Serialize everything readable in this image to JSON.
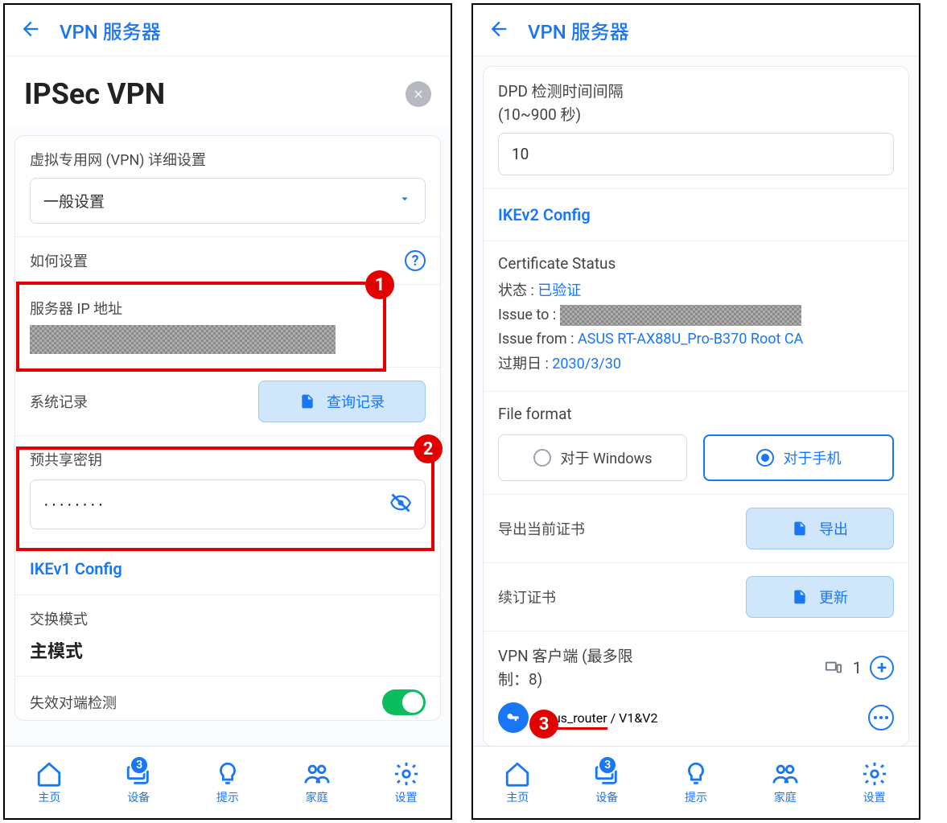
{
  "left": {
    "header_title": "VPN 服务器",
    "page_title": "IPSec VPN",
    "detail_label": "虚拟专用网 (VPN) 详细设置",
    "detail_value": "一般设置",
    "how_to": "如何设置",
    "server_ip_label": "服务器 IP 地址",
    "syslog_label": "系统记录",
    "query_btn": "查询记录",
    "psk_label": "预共享密钥",
    "psk_value": "········",
    "ikev1_title": "IKEv1 Config",
    "exchange_label": "交换模式",
    "exchange_value": "主模式",
    "dpd_label_partial": "失效对端检测",
    "callout1": "1",
    "callout2": "2"
  },
  "right": {
    "header_title": "VPN 服务器",
    "dpd_label1": "DPD 检测时间间隔",
    "dpd_label2": "(10~900 秒)",
    "dpd_value": "10",
    "ikev2_title": "IKEv2 Config",
    "cert_status_label": "Certificate Status",
    "status_label": "状态 : ",
    "status_value": "已验证",
    "issue_to_label": "Issue to : ",
    "issue_from_label": "Issue from : ",
    "issue_from_value": "ASUS RT-AX88U_Pro-B370 Root CA",
    "expiry_label": "过期日 : ",
    "expiry_value": "2030/3/30",
    "file_format_label": "File format",
    "radio_windows": "对于 Windows",
    "radio_mobile": "对于手机",
    "export_label": "导出当前证书",
    "export_btn": "导出",
    "renew_label": "续订证书",
    "renew_btn": "更新",
    "client_label1": "VPN 客户端 (最多限",
    "client_label2": "制：8)",
    "client_count": "1",
    "user_name": "asus_router",
    "user_suffix": " / V1&V2",
    "callout3": "3"
  },
  "nav": {
    "home": "主页",
    "device": "设备",
    "tip": "提示",
    "family": "家庭",
    "settings": "设置",
    "badge": "3"
  }
}
